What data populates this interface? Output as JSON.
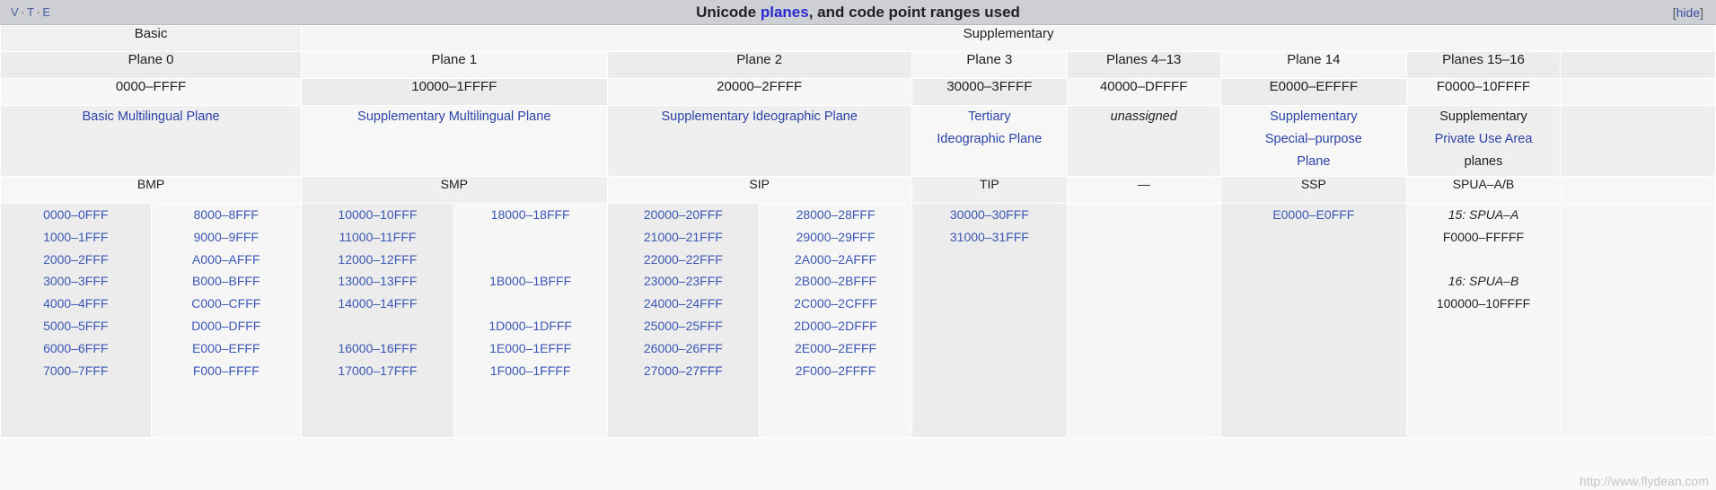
{
  "navbar": {
    "v": "V",
    "t": "T",
    "e": "E",
    "dot": "·",
    "title_pre": "Unicode ",
    "title_link": "planes",
    "title_post": ", and code point ranges used",
    "hide_open": "[",
    "hide_label": "hide",
    "hide_close": "]"
  },
  "groups": {
    "basic": "Basic",
    "supplementary": "Supplementary"
  },
  "planes": {
    "p0": "Plane 0",
    "p1": "Plane 1",
    "p2": "Plane 2",
    "p3": "Plane 3",
    "p4_13": "Planes 4–13",
    "p14": "Plane 14",
    "p15_16": "Planes 15–16"
  },
  "ranges": {
    "p0": "0000–FFFF",
    "p1": "10000–1FFFF",
    "p2": "20000–2FFFF",
    "p3": "30000–3FFFF",
    "p4_13": "40000–DFFFF",
    "p14": "E0000–EFFFF",
    "p15_16": "F0000–10FFFF"
  },
  "names": {
    "p0": "Basic Multilingual Plane",
    "p1": "Supplementary Multilingual Plane",
    "p2": "Supplementary Ideographic Plane",
    "p3_line1": "Tertiary",
    "p3_line2": "Ideographic Plane",
    "p4_13": "unassigned",
    "p14_line1": "Supplementary",
    "p14_line2": "Special–purpose",
    "p14_line3": "Plane",
    "p15_16_line1": "Supplementary",
    "p15_16_line2": "Private Use Area",
    "p15_16_line3": "planes"
  },
  "abbr": {
    "p0": "BMP",
    "p1": "SMP",
    "p2": "SIP",
    "p3": "TIP",
    "p4_13": "—",
    "p14": "SSP",
    "p15_16": "SPUA–A/B"
  },
  "columns": {
    "bmp_a": [
      "0000–0FFF",
      "1000–1FFF",
      "2000–2FFF",
      "3000–3FFF",
      "4000–4FFF",
      "5000–5FFF",
      "6000–6FFF",
      "7000–7FFF"
    ],
    "bmp_b": [
      "8000–8FFF",
      "9000–9FFF",
      "A000–AFFF",
      "B000–BFFF",
      "C000–CFFF",
      "D000–DFFF",
      "E000–EFFF",
      "F000–FFFF"
    ],
    "smp_a": [
      "10000–10FFF",
      "11000–11FFF",
      "12000–12FFF",
      "13000–13FFF",
      "14000–14FFF",
      "",
      "16000–16FFF",
      "17000–17FFF"
    ],
    "smp_b": [
      "18000–18FFF",
      "",
      "",
      "1B000–1BFFF",
      "",
      "1D000–1DFFF",
      "1E000–1EFFF",
      "1F000–1FFFF"
    ],
    "sip_a": [
      "20000–20FFF",
      "21000–21FFF",
      "22000–22FFF",
      "23000–23FFF",
      "24000–24FFF",
      "25000–25FFF",
      "26000–26FFF",
      "27000–27FFF"
    ],
    "sip_b": [
      "28000–28FFF",
      "29000–29FFF",
      "2A000–2AFFF",
      "2B000–2BFFF",
      "2C000–2CFFF",
      "2D000–2DFFF",
      "2E000–2EFFF",
      "2F000–2FFFF"
    ],
    "tip": [
      "30000–30FFF",
      "31000–31FFF"
    ],
    "p4_13": [],
    "ssp": [
      "E0000–E0FFF"
    ],
    "spua": {
      "a_label": "15: SPUA–A",
      "a_range": "F0000–FFFFF",
      "b_label": "16: SPUA–B",
      "b_range": "100000–10FFFF"
    }
  },
  "watermark": "http://www.flydean.com"
}
